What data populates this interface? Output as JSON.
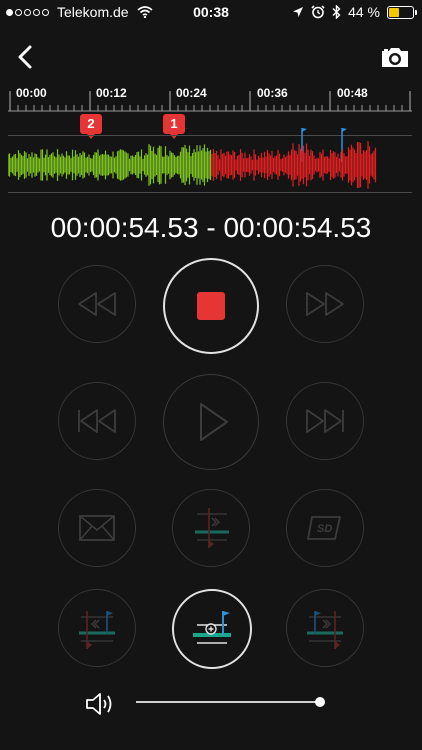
{
  "status_bar": {
    "carrier": "Telekom.de",
    "time": "00:38",
    "battery": "44 %",
    "battery_level": 0.44,
    "signal_bars_filled": 1,
    "signal_bars_total": 5
  },
  "nav": {
    "back_icon": "chevron-left-icon",
    "camera_icon": "camera-icon"
  },
  "timeline": {
    "tick_labels": [
      "00:00",
      "00:12",
      "00:24",
      "00:36",
      "00:48"
    ],
    "markers": [
      "2",
      "1"
    ]
  },
  "time_range": "00:00:54.53 - 00:00:54.53",
  "controls": {
    "rewind_icon": "rewind-icon",
    "stop_icon": "stop-icon",
    "fast_forward_icon": "fast-forward-icon",
    "skip_back_icon": "skip-back-icon",
    "play_icon": "play-icon",
    "skip_forward_icon": "skip-forward-icon",
    "mail_icon": "mail-icon",
    "split_icon": "split-marker-icon",
    "sd_card_icon": "sd-card-icon",
    "prev_marker_icon": "previous-marker-icon",
    "add_marker_icon": "add-marker-icon",
    "next_marker_icon": "next-marker-icon"
  },
  "volume": {
    "icon": "speaker-icon",
    "level": 1.0
  },
  "colors": {
    "recorded_wave": "#7ec41f",
    "live_wave": "#e02020",
    "marker": "#e53535",
    "flag": "#2f8fd8",
    "accent_teal": "#1aa88a",
    "battery_fill": "#f5c800"
  }
}
